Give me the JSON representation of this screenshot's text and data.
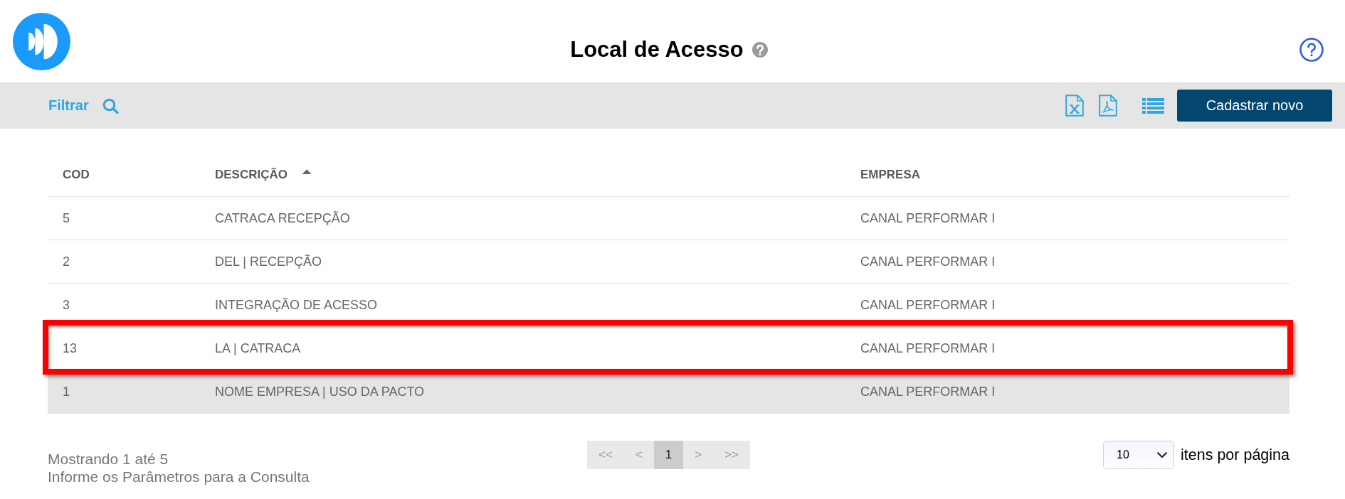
{
  "header": {
    "title": "Local de Acesso"
  },
  "toolbar": {
    "filter": "Filtrar",
    "primary_button": "Cadastrar novo"
  },
  "table": {
    "columns": [
      {
        "label": "COD",
        "sorted": false
      },
      {
        "label": "DESCRIÇÃO",
        "sorted": true
      },
      {
        "label": "EMPRESA",
        "sorted": false
      }
    ],
    "rows": [
      {
        "cells": [
          "5",
          "CATRACA RECEPÇÃO",
          "CANAL PERFORMAR I"
        ],
        "highlighted": false,
        "hovered": false
      },
      {
        "cells": [
          "2",
          "DEL | RECEPÇÃO",
          "CANAL PERFORMAR I"
        ],
        "highlighted": false,
        "hovered": false
      },
      {
        "cells": [
          "3",
          "INTEGRAÇÃO DE ACESSO",
          "CANAL PERFORMAR I"
        ],
        "highlighted": false,
        "hovered": false
      },
      {
        "cells": [
          "13",
          "LA | CATRACA",
          "CANAL PERFORMAR I"
        ],
        "highlighted": true,
        "hovered": false
      },
      {
        "cells": [
          "1",
          "NOME EMPRESA | USO DA PACTO",
          "CANAL PERFORMAR I"
        ],
        "highlighted": false,
        "hovered": true
      }
    ]
  },
  "footer": {
    "summary": "Mostrando 1 até 5",
    "hint": "Informe os Parâmetros para a Consulta",
    "pagination": [
      {
        "label": "<<",
        "selected": false
      },
      {
        "label": "<",
        "selected": false
      },
      {
        "label": "1",
        "selected": true
      },
      {
        "label": ">",
        "selected": false
      },
      {
        "label": ">>",
        "selected": false
      }
    ],
    "page_size": {
      "value": "10",
      "label": "itens por página"
    }
  }
}
